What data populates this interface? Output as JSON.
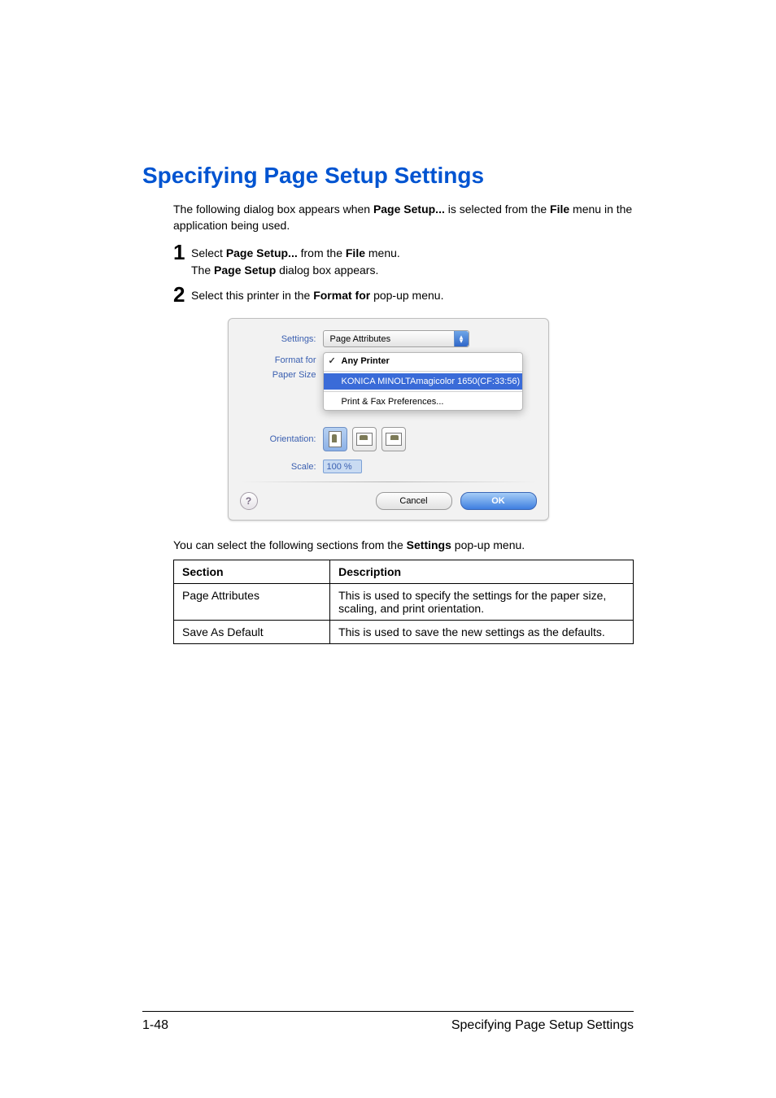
{
  "heading": "Specifying Page Setup Settings",
  "intro": {
    "part1": "The following dialog box appears when ",
    "bold1": "Page Setup...",
    "part2": " is selected from the ",
    "bold2": "File",
    "part3": " menu in the application being used."
  },
  "steps": [
    {
      "num": "1",
      "line1_a": "Select ",
      "line1_bold1": "Page Setup...",
      "line1_b": " from the ",
      "line1_bold2": "File",
      "line1_c": " menu.",
      "line2_a": "The ",
      "line2_bold": "Page Setup",
      "line2_b": " dialog box appears."
    },
    {
      "num": "2",
      "line1_a": "Select this printer in the ",
      "line1_bold1": "Format for",
      "line1_b": " pop-up menu."
    }
  ],
  "screenshot": {
    "labels": {
      "settings": "Settings:",
      "format_for": "Format for",
      "paper_size": "Paper Size",
      "orientation": "Orientation:",
      "scale": "Scale:"
    },
    "settings_value": "Page Attributes",
    "dropdown": {
      "any_printer": "Any Printer",
      "highlighted": "KONICA MINOLTAmagicolor 1650(CF:33:56)",
      "prefs": "Print & Fax Preferences..."
    },
    "scale_value": "100 %",
    "buttons": {
      "help": "?",
      "cancel": "Cancel",
      "ok": "OK"
    }
  },
  "after_text": {
    "a": "You can select the following sections from the ",
    "bold": "Settings",
    "b": " pop-up menu."
  },
  "table": {
    "header_section": "Section",
    "header_description": "Description",
    "rows": [
      {
        "section": "Page Attributes",
        "description": "This is used to specify the settings for the paper size, scaling, and print orientation."
      },
      {
        "section": "Save As Default",
        "description": "This is used to save the new settings as the defaults."
      }
    ]
  },
  "footer": {
    "page_num": "1-48",
    "title": "Specifying Page Setup Settings"
  }
}
